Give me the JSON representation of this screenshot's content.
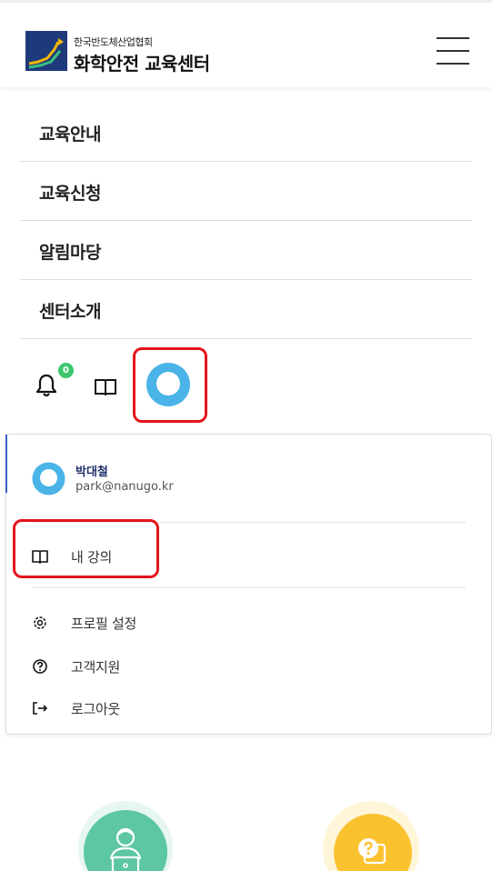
{
  "header": {
    "org_small": "한국반도체산업협회",
    "org_title": "화학안전 교육센터",
    "logo_colors": {
      "navy": "#1f3a7a",
      "gold": "#f2b707",
      "green": "#3bbf82"
    }
  },
  "nav": {
    "items": [
      {
        "label": "교육안내"
      },
      {
        "label": "교육신청"
      },
      {
        "label": "알림마당"
      },
      {
        "label": "센터소개"
      }
    ]
  },
  "toolbar": {
    "notification_count": "0",
    "icons": [
      "bell-icon",
      "book-icon",
      "avatar"
    ]
  },
  "user_menu": {
    "name": "박대철",
    "email": "park@nanugo.kr",
    "items": [
      {
        "label": "내 강의",
        "icon": "book-icon"
      },
      {
        "label": "프로필 설정",
        "icon": "gear-icon"
      },
      {
        "label": "고객지원",
        "icon": "help-icon"
      },
      {
        "label": "로그아웃",
        "icon": "logout-icon"
      }
    ]
  },
  "colors": {
    "highlight": "#e4141b",
    "avatar": "#4ab3e8",
    "badge": "#3ec66e",
    "accent_blue": "#3461c9",
    "tile_green": "#5cc7a0",
    "tile_yellow": "#f9c22e"
  }
}
